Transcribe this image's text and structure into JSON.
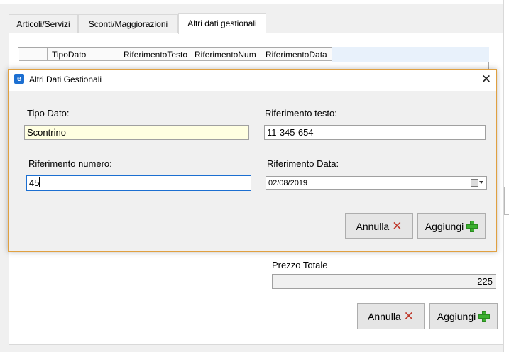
{
  "tabs": [
    {
      "label": "Articoli/Servizi"
    },
    {
      "label": "Sconti/Maggiorazioni"
    },
    {
      "label": "Altri dati gestionali"
    }
  ],
  "grid": {
    "columns": [
      "TipoDato",
      "RiferimentoTesto",
      "RiferimentoNum",
      "RiferimentoData"
    ]
  },
  "footer": {
    "prezzo_totale_label": "Prezzo Totale",
    "prezzo_totale_value": "225",
    "annulla_label": "Annulla",
    "aggiungi_label": "Aggiungi"
  },
  "dialog": {
    "title": "Altri Dati Gestionali",
    "close_glyph": "✕",
    "app_icon_glyph": "e",
    "tipo_dato": {
      "label": "Tipo Dato:",
      "value": "Scontrino"
    },
    "riferimento_testo": {
      "label": "Riferimento testo:",
      "value": "11-345-654"
    },
    "riferimento_numero": {
      "label": "Riferimento numero:",
      "value": "45"
    },
    "riferimento_data": {
      "label": "Riferimento Data:",
      "value": "02/08/2019"
    },
    "annulla_label": "Annulla",
    "aggiungi_label": "Aggiungi"
  },
  "icons": {
    "cancel": "red-x-icon",
    "add": "green-plus-icon",
    "calendar": "calendar-icon"
  },
  "colors": {
    "dialog_border": "#e0a040",
    "highlight_field": "#ffffe1",
    "focus_border": "#1c6fd1",
    "cancel_x": "#c0392b",
    "add_plus": "#3cb030"
  }
}
